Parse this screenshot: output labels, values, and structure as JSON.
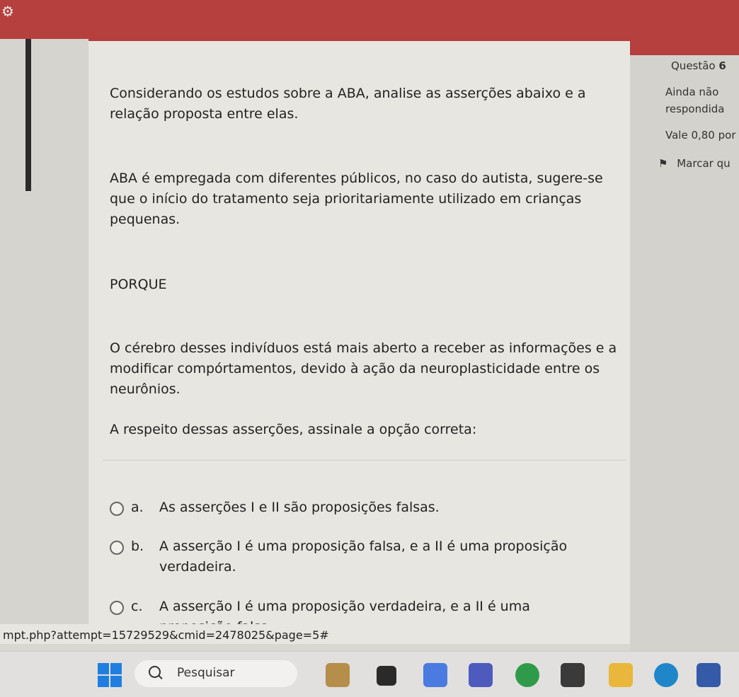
{
  "question_info": {
    "label": "Questão",
    "number": "6",
    "state": "Ainda não respondida",
    "value": "Vale 0,80 por",
    "flag_label": "Marcar qu"
  },
  "question": {
    "prompt": "Considerando os estudos sobre a ABA, analise as asserções abaixo e a relação proposta entre elas.",
    "assertion_1": "ABA é empregada com diferentes públicos, no caso do autista, sugere-se que o início do tratamento seja prioritariamente utilizado em crianças pequenas.",
    "connector": "PORQUE",
    "assertion_2": "O cérebro desses indivíduos está mais aberto a receber as informações e a modificar compórtamentos, devido à ação da neuroplasticidade entre os neurônios.",
    "instruction": "A respeito dessas asserções, assinale a opção correta:"
  },
  "options": [
    {
      "letter": "a.",
      "text": "As asserções I e II são proposições falsas."
    },
    {
      "letter": "b.",
      "text": "A asserção I é uma proposição falsa, e a II é uma proposição verdadeira."
    },
    {
      "letter": "c.",
      "text": "A asserção I é uma proposição verdadeira, e a II é uma proposição falsa"
    }
  ],
  "status_url": "mpt.php?attempt=15729529&cmid=2478025&page=5#",
  "taskbar": {
    "search_label": "Pesquisar"
  },
  "colors": {
    "header_red": "#b5403d",
    "page_bg": "#e8e6e1",
    "taskbar_bg": "#e1e0de",
    "start_blue": "#1f7fe0"
  }
}
